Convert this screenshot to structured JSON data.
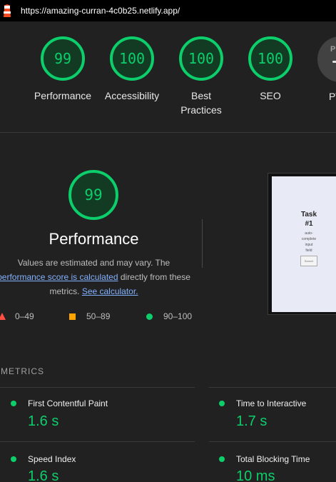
{
  "url": "https://amazing-curran-4c0b25.netlify.app/",
  "colors": {
    "pass": "#0cce6b",
    "average": "#ffa400",
    "fail": "#ff4e42"
  },
  "gauges": [
    {
      "score": "99",
      "label": "Performance"
    },
    {
      "score": "100",
      "label": "Accessibility"
    },
    {
      "score": "100",
      "label": "Best Practices"
    },
    {
      "score": "100",
      "label": "SEO"
    }
  ],
  "pwa": {
    "label": "PWA"
  },
  "performance": {
    "score": "99",
    "title": "Performance",
    "desc_prefix": "Values are estimated and may vary. The ",
    "desc_link1": "performance score is calculated",
    "desc_middle": " directly from these metrics. ",
    "desc_link2": "See calculator."
  },
  "legend": [
    {
      "range": "0–49",
      "icon": "red-triangle"
    },
    {
      "range": "50–89",
      "icon": "orange-square"
    },
    {
      "range": "90–100",
      "icon": "green-circle"
    }
  ],
  "screenshot": {
    "title_line1": "Task",
    "title_line2": "#1",
    "subtitle_line1": "auto-",
    "subtitle_line2": "complete",
    "subtitle_line3": "input",
    "subtitle_line4": "field",
    "button": "Search"
  },
  "metrics_header": "METRICS",
  "metrics": [
    {
      "name": "First Contentful Paint",
      "value": "1.6 s"
    },
    {
      "name": "Time to Interactive",
      "value": "1.7 s"
    },
    {
      "name": "Speed Index",
      "value": "1.6 s"
    },
    {
      "name": "Total Blocking Time",
      "value": "10 ms"
    }
  ]
}
